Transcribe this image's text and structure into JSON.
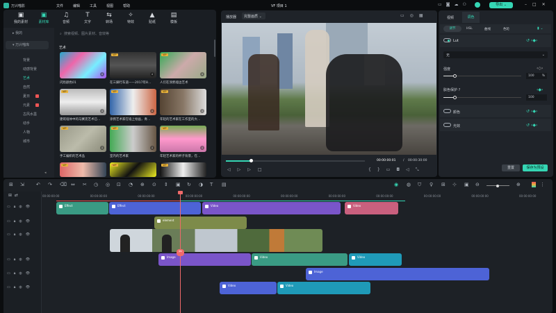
{
  "app": {
    "name": "万兴喵影",
    "project_title": "VF 项目 1",
    "menus": [
      "文件",
      "编辑",
      "工具",
      "视图",
      "帮助"
    ],
    "export_label": "导出",
    "accent": "#35d6b4"
  },
  "toolbar_tabs": [
    {
      "label": "我的素材",
      "icon": "image-icon"
    },
    {
      "label": "素材库",
      "icon": "library-icon"
    },
    {
      "label": "音频",
      "icon": "music-icon"
    },
    {
      "label": "文字",
      "icon": "text-icon"
    },
    {
      "label": "转场",
      "icon": "transition-icon"
    },
    {
      "label": "特效",
      "icon": "effects-icon"
    },
    {
      "label": "贴纸",
      "icon": "sticker-icon"
    },
    {
      "label": "模板",
      "icon": "template-icon"
    }
  ],
  "active_tab": 1,
  "library": {
    "sidebar": [
      "我的",
      "万兴喵库",
      "背景",
      "动感背景",
      "艺术",
      "自然",
      "夏日",
      "元素",
      "古风水墨",
      "动手",
      "人物",
      "城市"
    ],
    "active_item": "艺术",
    "search_placeholder": "搜索视频、图片素材、音效等",
    "section_title": "艺术",
    "items": [
      {
        "label": "闪烁颜色01",
        "vip": false
      },
      {
        "label": "在三脚行车道——2017年8…",
        "vip": true
      },
      {
        "label": "人们在涂鸦墙边艺术",
        "vip": true
      },
      {
        "label": "建筑墙体中的马赛克艺术已…",
        "vip": true
      },
      {
        "label": "涂鸦艺术家在墙上绘画，青…",
        "vip": true
      },
      {
        "label": "年轻的艺术家在工作室的大…",
        "vip": true
      },
      {
        "label": "手工编织的艺术品",
        "vip": true
      },
      {
        "label": "室内的艺术家",
        "vip": true
      },
      {
        "label": "年轻艺术家的杯子背景，在…",
        "vip": true
      },
      {
        "label": "",
        "vip": true
      },
      {
        "label": "",
        "vip": true
      },
      {
        "label": "",
        "vip": true
      }
    ],
    "vip_label": "VIP"
  },
  "preview": {
    "mode_label": "播放器",
    "quality_label": "完整画质",
    "current_time": "00:00:00:01",
    "separator": "/",
    "total_time": "00:00:30:00",
    "progress": 0.18
  },
  "inspector": {
    "tabs": [
      "视频",
      "调色"
    ],
    "active_tab": "调色",
    "subtabs": [
      "调节",
      "HSL",
      "曲线",
      "色轮"
    ],
    "lut_label": "Lut",
    "lut_value": "无",
    "strength_label": "强度",
    "strength_value": "100",
    "strength_unit": "%",
    "skin_label": "肤色保护",
    "skin_value": "100",
    "color_label": "颜色",
    "light_label": "光效",
    "reset_label": "重置",
    "save_preset_label": "保存为预设"
  },
  "timeline": {
    "ruler": [
      "00:00:00:00",
      "00:00:00:00",
      "00:00:00:00",
      "00:00:00:00",
      "00:00:00:00",
      "00:00:00:00",
      "00:00:00:00",
      "00:00:00:00",
      "00:00:00:00",
      "00:00:00:00",
      "00:00:00:00",
      "00:00:00:00"
    ],
    "clips": [
      {
        "label": "Effect",
        "color": "#3a9b84",
        "track": 0
      },
      {
        "label": "Effect",
        "color": "#4d63d6",
        "track": 0
      },
      {
        "label": "Video",
        "color": "#7a55c9",
        "track": 0
      },
      {
        "label": "Video",
        "color": "#c9607e",
        "track": 0
      },
      {
        "label": "element",
        "color": "#7d8b4a",
        "track": 1
      },
      {
        "label": "Image",
        "color": "#7a55c9",
        "track": 3
      },
      {
        "label": "Video",
        "color": "#3a9b84",
        "track": 3
      },
      {
        "label": "Video",
        "color": "#1f9ab8",
        "track": 3
      },
      {
        "label": "Image",
        "color": "#4d63d6",
        "track": 4
      },
      {
        "label": "Video",
        "color": "#4d63d6",
        "track": 5
      },
      {
        "label": "Video",
        "color": "#1f9ab8",
        "track": 5
      }
    ]
  }
}
